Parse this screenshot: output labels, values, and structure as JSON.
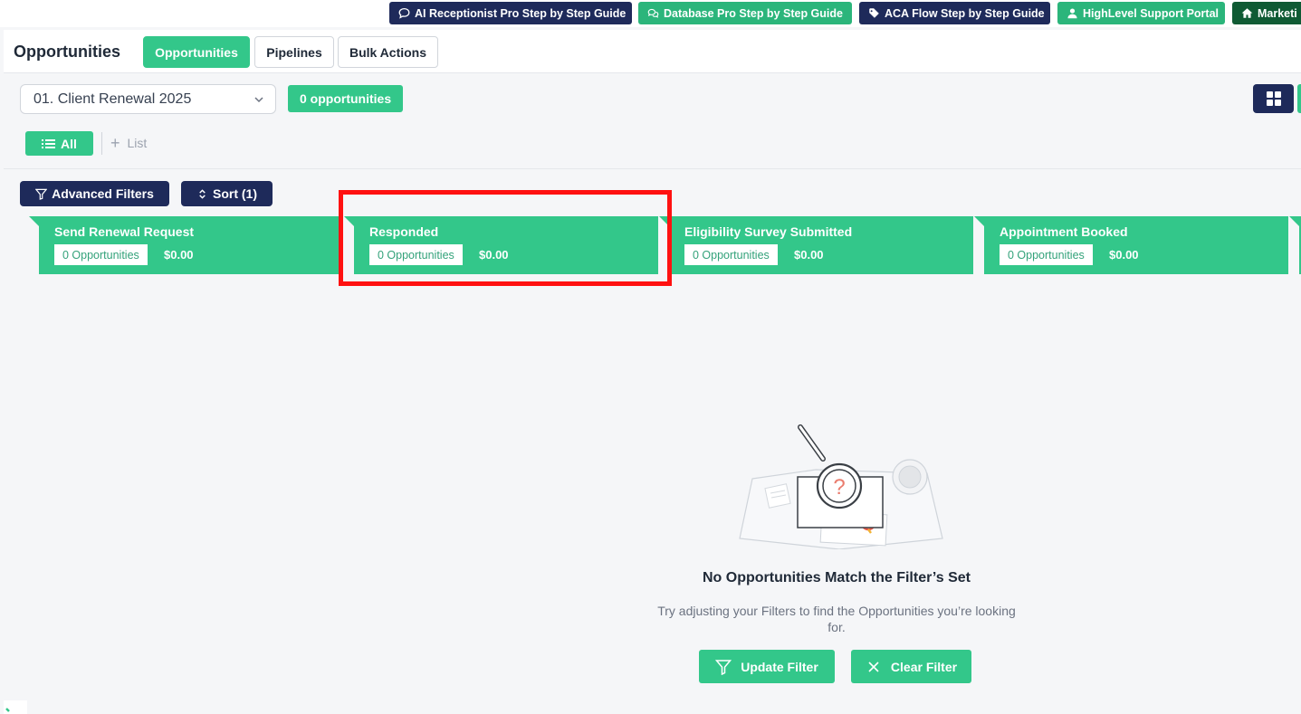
{
  "guides": [
    {
      "label": "AI Receptionist Pro Step by Step Guide",
      "icon": "chat-bubble-icon",
      "color": "#1e2a5a"
    },
    {
      "label": "Database Pro Step by Step Guide",
      "icon": "chat-bubbles-icon",
      "color": "#2bb57b"
    },
    {
      "label": "ACA Flow Step by Step Guide",
      "icon": "tag-icon",
      "color": "#1e2a5a"
    },
    {
      "label": "HighLevel Support Portal",
      "icon": "user-icon",
      "color": "#2bb57b"
    },
    {
      "label": "Marketi",
      "icon": "home-icon",
      "color": "#0f5a34"
    }
  ],
  "header": {
    "title": "Opportunities",
    "tabs": [
      {
        "label": "Opportunities",
        "active": true
      },
      {
        "label": "Pipelines",
        "active": false
      },
      {
        "label": "Bulk Actions",
        "active": false
      }
    ]
  },
  "toolbar": {
    "pipeline": "01. Client Renewal 2025",
    "count": "0 opportunities",
    "view_icon": "grid-icon"
  },
  "views": {
    "all_label": "All",
    "add_list_label": "List"
  },
  "filters": {
    "advanced_label": "Advanced Filters",
    "sort_label": "Sort (1)"
  },
  "stages": [
    {
      "name": "Send Renewal Request",
      "count": "0 Opportunities",
      "amount": "$0.00"
    },
    {
      "name": "Responded",
      "count": "0 Opportunities",
      "amount": "$0.00"
    },
    {
      "name": "Eligibility Survey Submitted",
      "count": "0 Opportunities",
      "amount": "$0.00"
    },
    {
      "name": "Appointment Booked",
      "count": "0 Opportunities",
      "amount": "$0.00"
    }
  ],
  "empty_state": {
    "title": "No Opportunities Match the Filter’s Set",
    "description": "Try adjusting your Filters to find the Opportunities you’re looking for.",
    "update_label": "Update Filter",
    "clear_label": "Clear Filter"
  },
  "colors": {
    "accent": "#33c78a",
    "navy": "#1e2a5a",
    "highlight": "#ff1111"
  }
}
